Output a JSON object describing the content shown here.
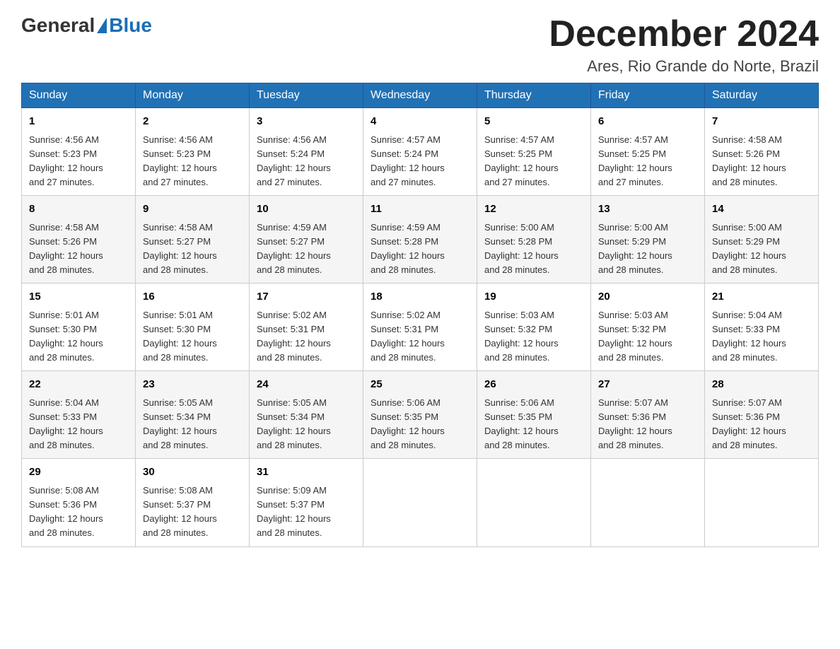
{
  "header": {
    "logo_general": "General",
    "logo_blue": "Blue",
    "month_title": "December 2024",
    "location": "Ares, Rio Grande do Norte, Brazil"
  },
  "days_of_week": [
    "Sunday",
    "Monday",
    "Tuesday",
    "Wednesday",
    "Thursday",
    "Friday",
    "Saturday"
  ],
  "weeks": [
    [
      {
        "day": "1",
        "sunrise": "4:56 AM",
        "sunset": "5:23 PM",
        "daylight": "12 hours and 27 minutes."
      },
      {
        "day": "2",
        "sunrise": "4:56 AM",
        "sunset": "5:23 PM",
        "daylight": "12 hours and 27 minutes."
      },
      {
        "day": "3",
        "sunrise": "4:56 AM",
        "sunset": "5:24 PM",
        "daylight": "12 hours and 27 minutes."
      },
      {
        "day": "4",
        "sunrise": "4:57 AM",
        "sunset": "5:24 PM",
        "daylight": "12 hours and 27 minutes."
      },
      {
        "day": "5",
        "sunrise": "4:57 AM",
        "sunset": "5:25 PM",
        "daylight": "12 hours and 27 minutes."
      },
      {
        "day": "6",
        "sunrise": "4:57 AM",
        "sunset": "5:25 PM",
        "daylight": "12 hours and 27 minutes."
      },
      {
        "day": "7",
        "sunrise": "4:58 AM",
        "sunset": "5:26 PM",
        "daylight": "12 hours and 28 minutes."
      }
    ],
    [
      {
        "day": "8",
        "sunrise": "4:58 AM",
        "sunset": "5:26 PM",
        "daylight": "12 hours and 28 minutes."
      },
      {
        "day": "9",
        "sunrise": "4:58 AM",
        "sunset": "5:27 PM",
        "daylight": "12 hours and 28 minutes."
      },
      {
        "day": "10",
        "sunrise": "4:59 AM",
        "sunset": "5:27 PM",
        "daylight": "12 hours and 28 minutes."
      },
      {
        "day": "11",
        "sunrise": "4:59 AM",
        "sunset": "5:28 PM",
        "daylight": "12 hours and 28 minutes."
      },
      {
        "day": "12",
        "sunrise": "5:00 AM",
        "sunset": "5:28 PM",
        "daylight": "12 hours and 28 minutes."
      },
      {
        "day": "13",
        "sunrise": "5:00 AM",
        "sunset": "5:29 PM",
        "daylight": "12 hours and 28 minutes."
      },
      {
        "day": "14",
        "sunrise": "5:00 AM",
        "sunset": "5:29 PM",
        "daylight": "12 hours and 28 minutes."
      }
    ],
    [
      {
        "day": "15",
        "sunrise": "5:01 AM",
        "sunset": "5:30 PM",
        "daylight": "12 hours and 28 minutes."
      },
      {
        "day": "16",
        "sunrise": "5:01 AM",
        "sunset": "5:30 PM",
        "daylight": "12 hours and 28 minutes."
      },
      {
        "day": "17",
        "sunrise": "5:02 AM",
        "sunset": "5:31 PM",
        "daylight": "12 hours and 28 minutes."
      },
      {
        "day": "18",
        "sunrise": "5:02 AM",
        "sunset": "5:31 PM",
        "daylight": "12 hours and 28 minutes."
      },
      {
        "day": "19",
        "sunrise": "5:03 AM",
        "sunset": "5:32 PM",
        "daylight": "12 hours and 28 minutes."
      },
      {
        "day": "20",
        "sunrise": "5:03 AM",
        "sunset": "5:32 PM",
        "daylight": "12 hours and 28 minutes."
      },
      {
        "day": "21",
        "sunrise": "5:04 AM",
        "sunset": "5:33 PM",
        "daylight": "12 hours and 28 minutes."
      }
    ],
    [
      {
        "day": "22",
        "sunrise": "5:04 AM",
        "sunset": "5:33 PM",
        "daylight": "12 hours and 28 minutes."
      },
      {
        "day": "23",
        "sunrise": "5:05 AM",
        "sunset": "5:34 PM",
        "daylight": "12 hours and 28 minutes."
      },
      {
        "day": "24",
        "sunrise": "5:05 AM",
        "sunset": "5:34 PM",
        "daylight": "12 hours and 28 minutes."
      },
      {
        "day": "25",
        "sunrise": "5:06 AM",
        "sunset": "5:35 PM",
        "daylight": "12 hours and 28 minutes."
      },
      {
        "day": "26",
        "sunrise": "5:06 AM",
        "sunset": "5:35 PM",
        "daylight": "12 hours and 28 minutes."
      },
      {
        "day": "27",
        "sunrise": "5:07 AM",
        "sunset": "5:36 PM",
        "daylight": "12 hours and 28 minutes."
      },
      {
        "day": "28",
        "sunrise": "5:07 AM",
        "sunset": "5:36 PM",
        "daylight": "12 hours and 28 minutes."
      }
    ],
    [
      {
        "day": "29",
        "sunrise": "5:08 AM",
        "sunset": "5:36 PM",
        "daylight": "12 hours and 28 minutes."
      },
      {
        "day": "30",
        "sunrise": "5:08 AM",
        "sunset": "5:37 PM",
        "daylight": "12 hours and 28 minutes."
      },
      {
        "day": "31",
        "sunrise": "5:09 AM",
        "sunset": "5:37 PM",
        "daylight": "12 hours and 28 minutes."
      },
      null,
      null,
      null,
      null
    ]
  ],
  "labels": {
    "sunrise": "Sunrise:",
    "sunset": "Sunset:",
    "daylight": "Daylight:"
  }
}
